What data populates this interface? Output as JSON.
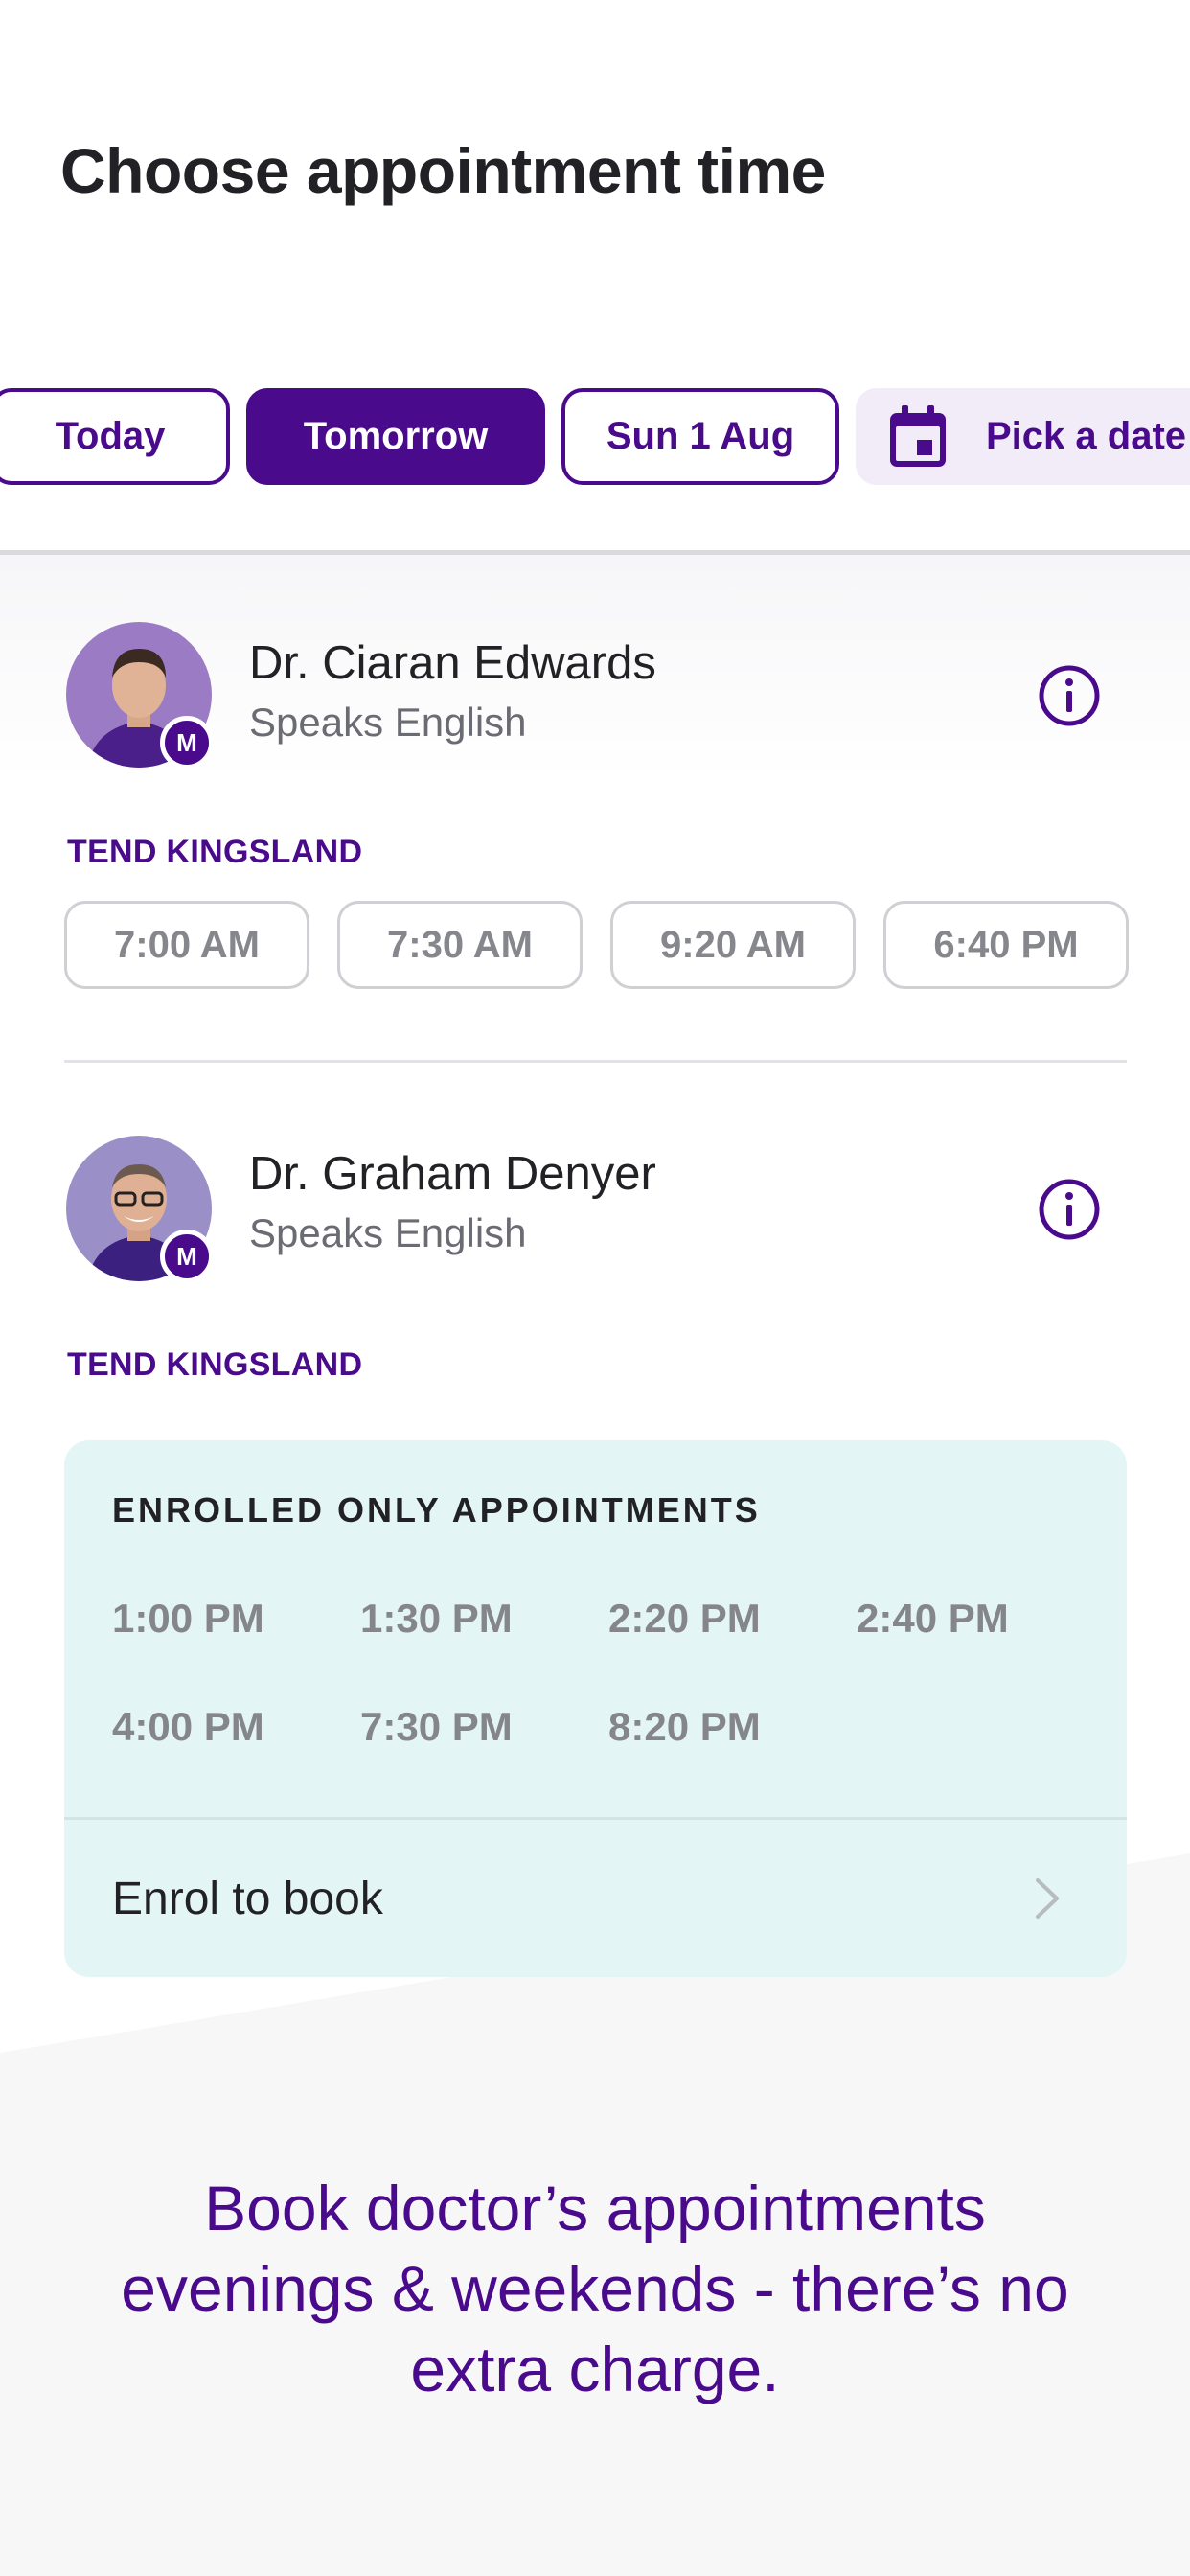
{
  "page": {
    "title": "Choose appointment time"
  },
  "dates": {
    "today": "Today",
    "tomorrow": "Tomorrow",
    "sun": "Sun 1 Aug",
    "pick": "Pick a date"
  },
  "doctors": [
    {
      "name": "Dr. Ciaran Edwards",
      "language": "Speaks English",
      "badge": "M",
      "location": "TEND KINGSLAND",
      "slots": [
        "7:00 AM",
        "7:30 AM",
        "9:20 AM",
        "6:40 PM"
      ]
    },
    {
      "name": "Dr. Graham Denyer",
      "language": "Speaks English",
      "badge": "M",
      "location": "TEND KINGSLAND",
      "enrolled": {
        "title": "ENROLLED ONLY APPOINTMENTS",
        "slots": [
          "1:00 PM",
          "1:30 PM",
          "2:20 PM",
          "2:40 PM",
          "4:00 PM",
          "7:30 PM",
          "8:20 PM"
        ],
        "cta": "Enrol to book"
      }
    }
  ],
  "footer": {
    "text": "Book doctor’s appointments evenings & weekends - there’s no extra charge."
  },
  "colors": {
    "brand": "#4a0a8c",
    "enrolled_bg": "#e3f5f4",
    "muted": "#86868d"
  },
  "icons": [
    "calendar-icon",
    "info-icon",
    "chevron-right-icon"
  ]
}
